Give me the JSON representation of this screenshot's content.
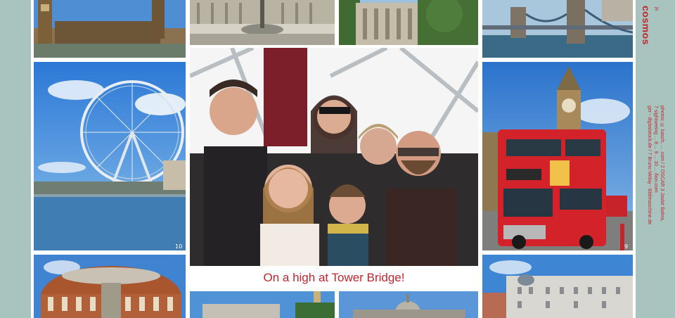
{
  "caption": "On a high at Tower Bridge!",
  "eye_badge": "10",
  "bus_badge": "9",
  "brand": {
    "name": "cosmos",
    "sub": "jo"
  },
  "credits_line_1": "photos: © kasch, ... .com / 2 OSCAR  3 Jasbir Bahra,",
  "credits_line_2": "7 sightseeing ... 8 ... 9 ... 10 ... /lion.com",
  "credits_line_3": "ger - digitalstock.de / 7 Bruno Mölay - Bildmaschine.de",
  "colors": {
    "accent_red": "#c0262d",
    "background": "#a9c4bf"
  }
}
